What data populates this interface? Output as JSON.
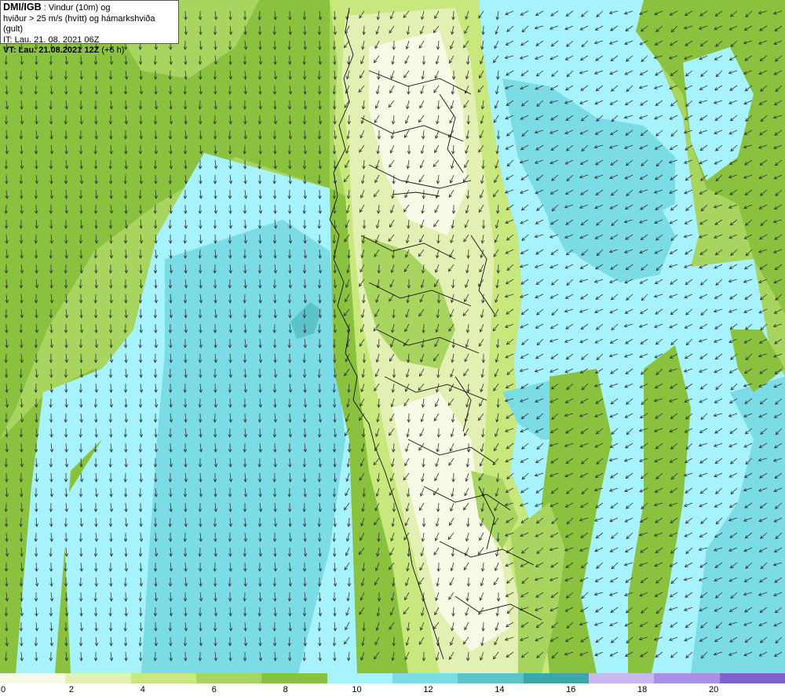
{
  "header": {
    "brand": "DMI/IGB",
    "line1_rest": " : Vindur (10m) og",
    "line2": "hviður > 25 m/s (hvítt) og hámarkshviða (gult)",
    "line3": "IT: Lau. 21. 08. 2021 06Z",
    "line4_bold": "VT: Lau. 21.08.2021 12Z",
    "line4_rest": " (+6 h)"
  },
  "legend": {
    "colors": [
      "#f7fbe6",
      "#e3f0b3",
      "#c8e87e",
      "#a8d460",
      "#8ac13e",
      "#a6f2ff",
      "#7cdce6",
      "#5cc4c8",
      "#3aa8a8",
      "#c8b8f0",
      "#a890e8",
      "#8060d0"
    ],
    "labels": [
      "0",
      "2",
      "4",
      "6",
      "8",
      "10",
      "12",
      "14",
      "16",
      "18",
      "20"
    ],
    "label_color": "#000000"
  },
  "map": {
    "colors": {
      "sea_cyan": "#a6f2ff",
      "sea_teal": "#7cdce6",
      "sea_deep": "#5cc4c8",
      "land_green": "#8ac13e",
      "land_mid": "#a8d460",
      "land_light": "#c8e87e",
      "land_pale": "#e3f0b3",
      "land_white": "#f7fbe6",
      "arrows": "#333333",
      "coast": "#111111"
    }
  }
}
